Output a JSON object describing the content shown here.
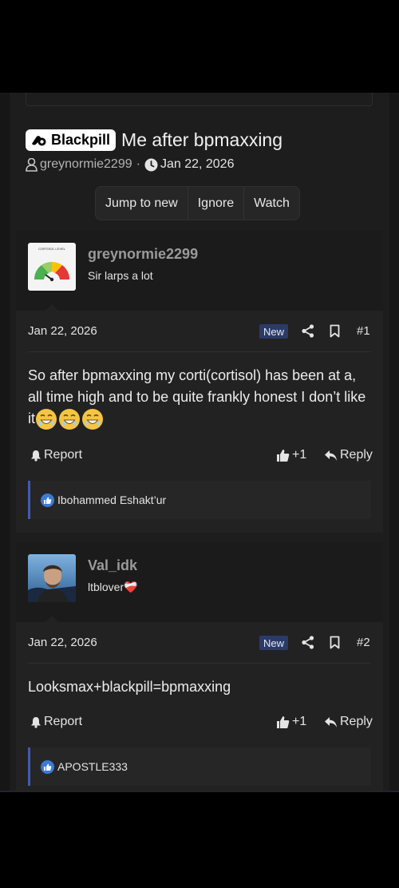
{
  "thread": {
    "prefix": "Blackpill",
    "title": "Me after bpmaxxing",
    "author": "greynormie2299",
    "separator": "·",
    "date": "Jan 22, 2026",
    "actions": {
      "jump": "Jump to new",
      "ignore": "Ignore",
      "watch": "Watch"
    }
  },
  "posts": [
    {
      "username": "greynormie2299",
      "user_title": "Sir larps a lot",
      "date": "Jan 22, 2026",
      "badge": "New",
      "number": "#1",
      "body": "So after bpmaxxing my corti(cortisol) has been at a, all time high and to be quite frankly honest I don’t like it",
      "emoji": "grinning-sweat-face x3",
      "report": "Report",
      "like_count": "+1",
      "reply": "Reply",
      "reacted_by": "Ibohammed Eshakt’ur",
      "avatar_caption": "CORTISOL LEVEL"
    },
    {
      "username": "Val_idk",
      "user_title": "ltblover❤️‍🩹",
      "date": "Jan 22, 2026",
      "badge": "New",
      "number": "#2",
      "body": "Looksmax+blackpill=bpmaxxing",
      "report": "Report",
      "like_count": "+1",
      "reply": "Reply",
      "reacted_by": "APOSTLE333"
    }
  ],
  "colors": {
    "background": "#1d1d1d",
    "post_background": "#222222",
    "new_badge": "#2b3a68",
    "reaction_accent": "#3f5bb4",
    "like_icon": "#3b7bd4"
  }
}
